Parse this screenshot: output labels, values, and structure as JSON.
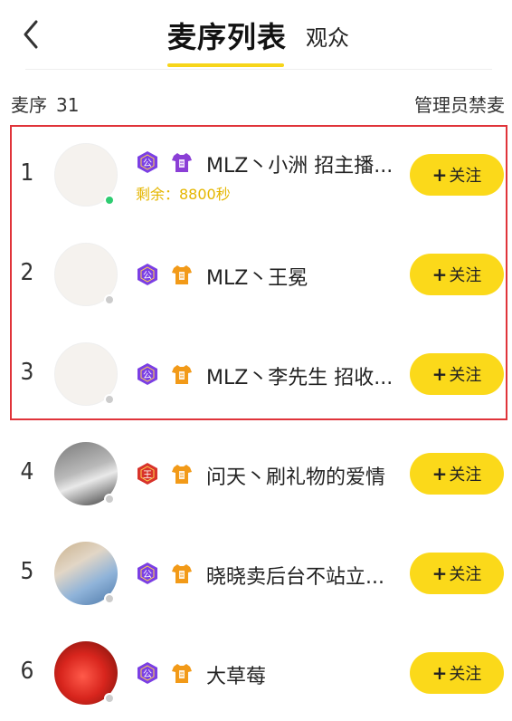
{
  "header": {
    "tab_active": "麦序列表",
    "tab_other": "观众"
  },
  "subbar": {
    "label": "麦序",
    "count": "31",
    "admin_action": "管理员禁麦"
  },
  "follow_label": "关注",
  "rows": [
    {
      "rank": "1",
      "name": "MLZ丶小洲 招主播...",
      "sub": "剩余：8800秒",
      "online": true,
      "badge_a": "公",
      "badge_a_color": "#7b3fe4",
      "badge_b_color": "#8b3fd6"
    },
    {
      "rank": "2",
      "name": "MLZ丶王冕",
      "online": false,
      "badge_a": "公",
      "badge_a_color": "#7b3fe4",
      "badge_b_color": "#f29a18"
    },
    {
      "rank": "3",
      "name": "MLZ丶李先生 招收...",
      "online": false,
      "badge_a": "公",
      "badge_a_color": "#7b3fe4",
      "badge_b_color": "#f29a18"
    },
    {
      "rank": "4",
      "name": "问天丶刷礼物的爱情",
      "online": false,
      "badge_a": "王",
      "badge_a_color": "#d8332b",
      "badge_b_color": "#f29a18"
    },
    {
      "rank": "5",
      "name": "晓晓卖后台不站立...",
      "online": false,
      "badge_a": "公",
      "badge_a_color": "#7b3fe4",
      "badge_b_color": "#f29a18"
    },
    {
      "rank": "6",
      "name": "大草莓",
      "online": false,
      "badge_a": "公",
      "badge_a_color": "#7b3fe4",
      "badge_b_color": "#f29a18"
    }
  ],
  "colors": {
    "accent_yellow": "#fbd91a",
    "online_green": "#2ecc71",
    "offline_gray": "#cccccc",
    "highlight_red": "#e0343a"
  },
  "icons": {
    "back": "chevron-left-icon",
    "badge_a": "hexagon-medal-icon",
    "badge_b": "shirt-icon"
  }
}
